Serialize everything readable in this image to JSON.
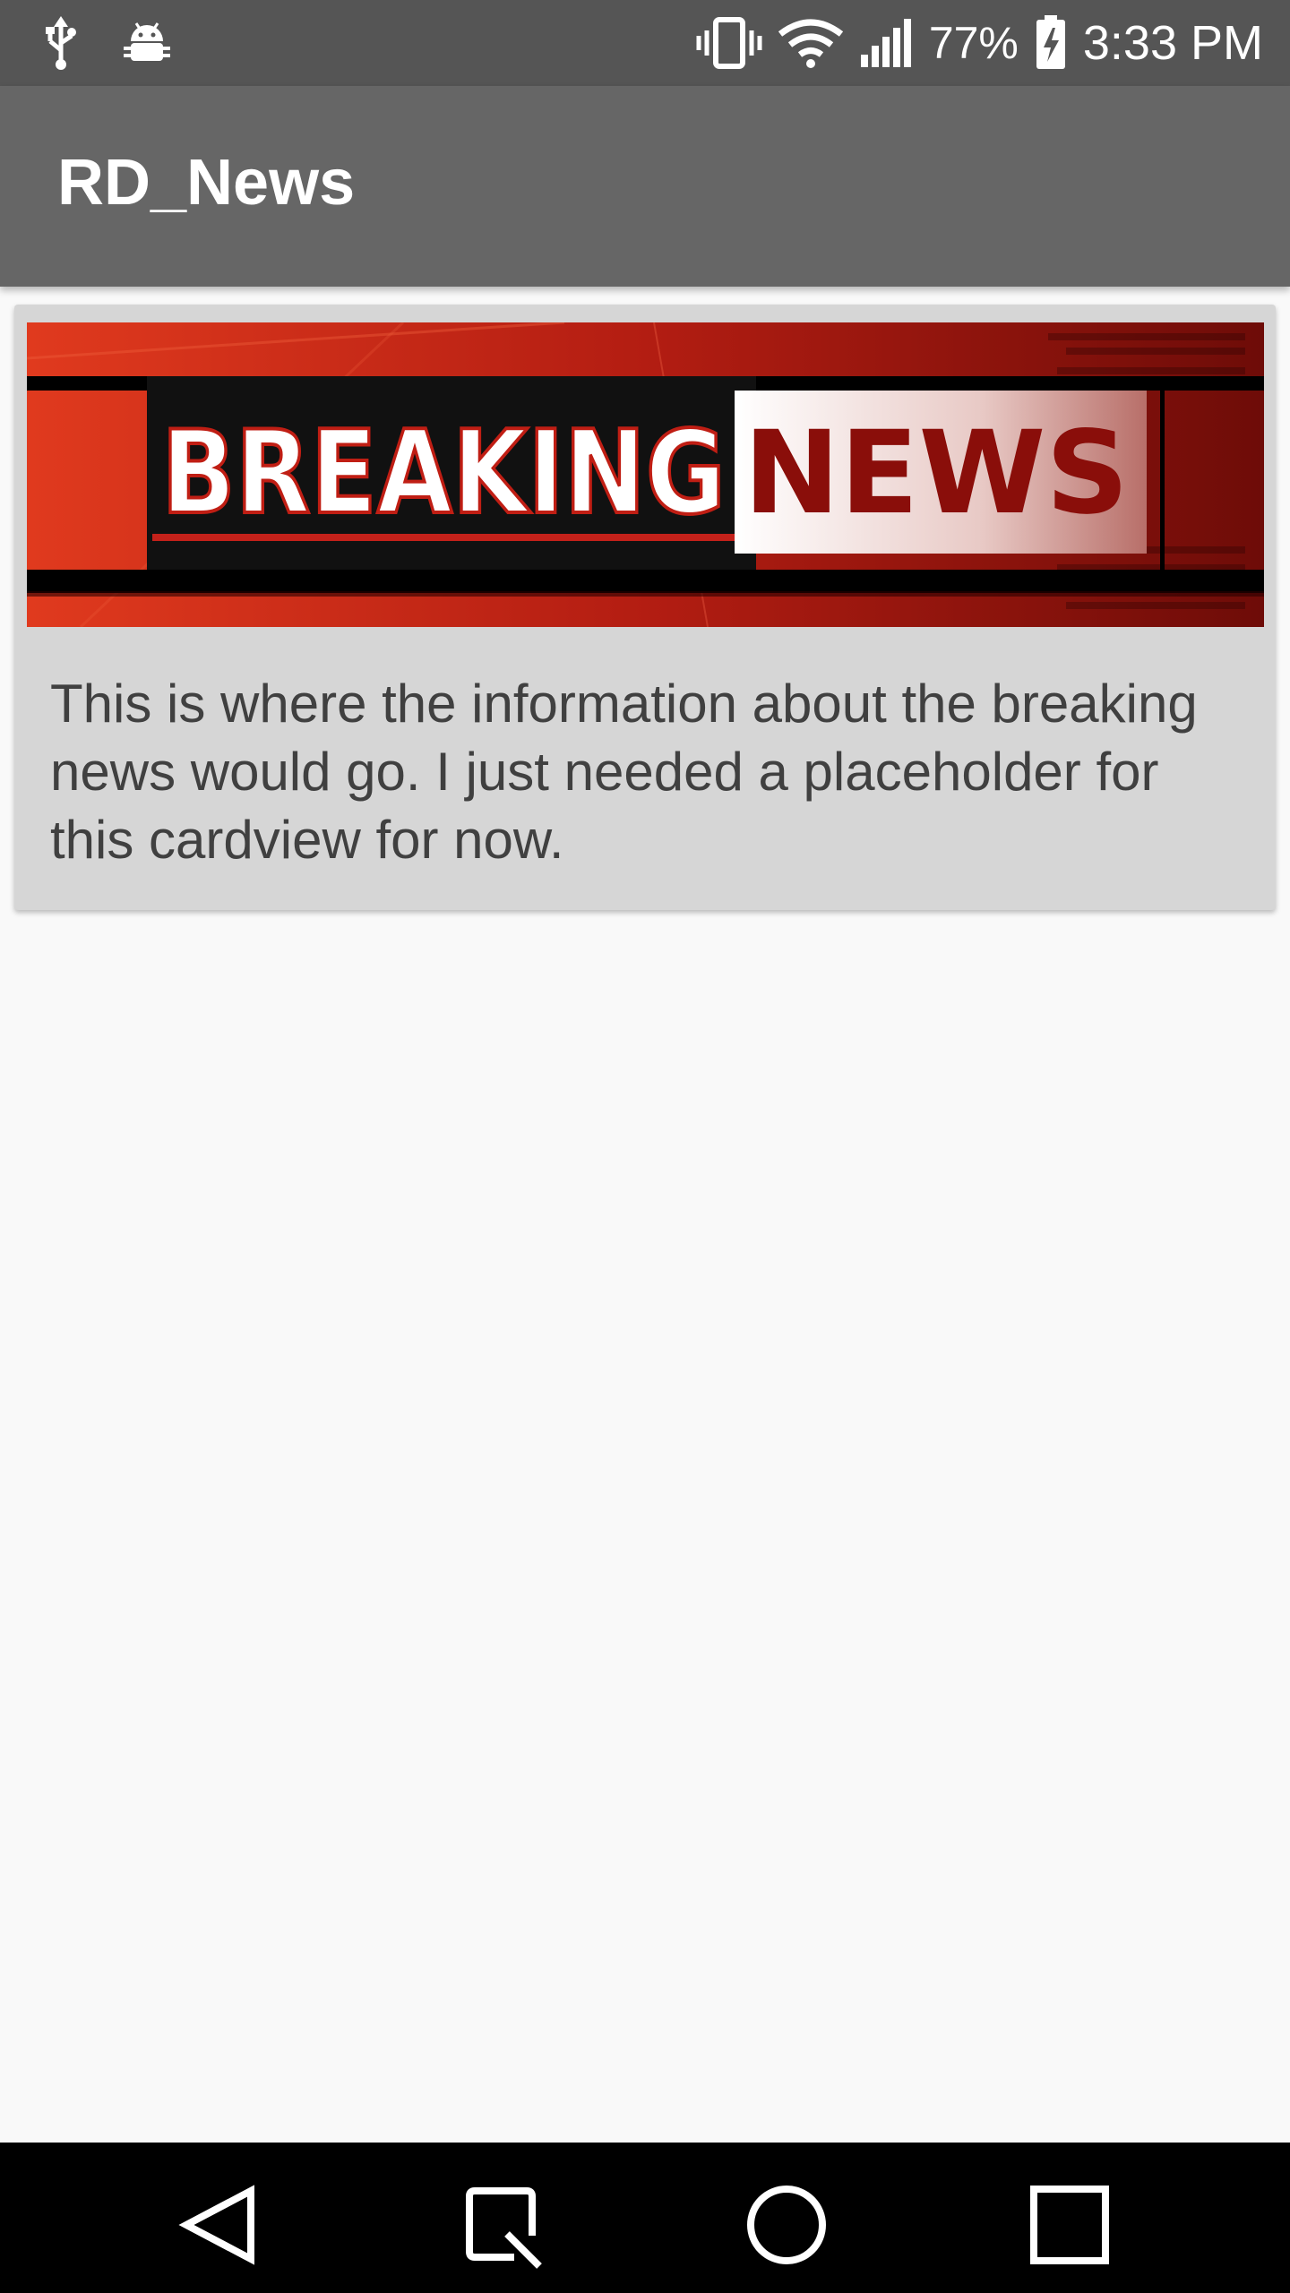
{
  "status_bar": {
    "battery_percent": "77%",
    "time": "3:33 PM",
    "icons": [
      "usb-icon",
      "android-debug-icon",
      "vibrate-icon",
      "wifi-icon",
      "signal-icon",
      "battery-charging-icon"
    ]
  },
  "app_bar": {
    "title": "RD_News"
  },
  "card": {
    "image": {
      "headline_word1": "BREAKING",
      "headline_word2": "NEWS"
    },
    "body_text": "This is where the information about the breaking news would go. I just needed a placeholder for this cardview for now."
  },
  "nav_bar": {
    "buttons": [
      "back-icon",
      "quick-memo-icon",
      "home-icon",
      "recents-icon"
    ]
  },
  "colors": {
    "status_bar": "#555555",
    "app_bar": "#666666",
    "card_background": "#d6d6d6",
    "page_background": "#f9f9f9",
    "banner_red": "#c62418"
  }
}
